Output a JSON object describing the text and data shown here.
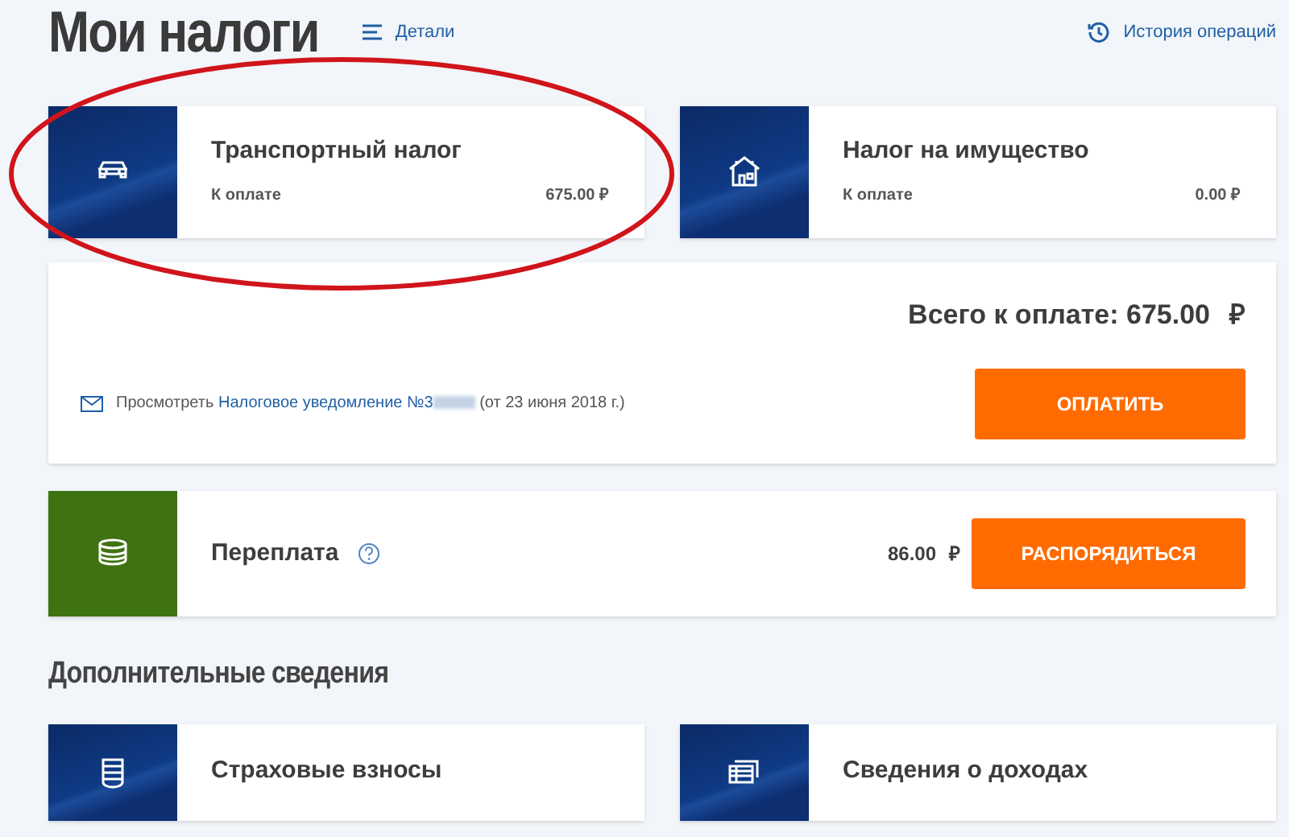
{
  "header": {
    "title": "Мои налоги",
    "details_link": "Детали",
    "history_link": "История операций"
  },
  "taxes": [
    {
      "kind": "car",
      "title": "Транспортный налог",
      "due_label": "К оплате",
      "amount": "675.00 ₽",
      "circled": true
    },
    {
      "kind": "house",
      "title": "Налог на имущество",
      "due_label": "К оплате",
      "amount": "0.00 ₽",
      "circled": false
    }
  ],
  "total": {
    "label": "Всего к оплате: 675.00",
    "currency": "₽",
    "view_text": "Просмотреть",
    "notice_link": "Налоговое уведомление №3",
    "notice_date": "(от 23 июня 2018 г.)",
    "redacted": true,
    "pay_button": "ОПЛАТИТЬ"
  },
  "overpayment": {
    "title": "Переплата",
    "amount": "86.00",
    "currency": "₽",
    "button": "РАСПОРЯДИТЬСЯ"
  },
  "additional": {
    "heading": "Дополнительные сведения",
    "items": [
      {
        "kind": "insurance",
        "title": "Страховые взносы"
      },
      {
        "kind": "income",
        "title": "Сведения о доходах"
      }
    ]
  }
}
